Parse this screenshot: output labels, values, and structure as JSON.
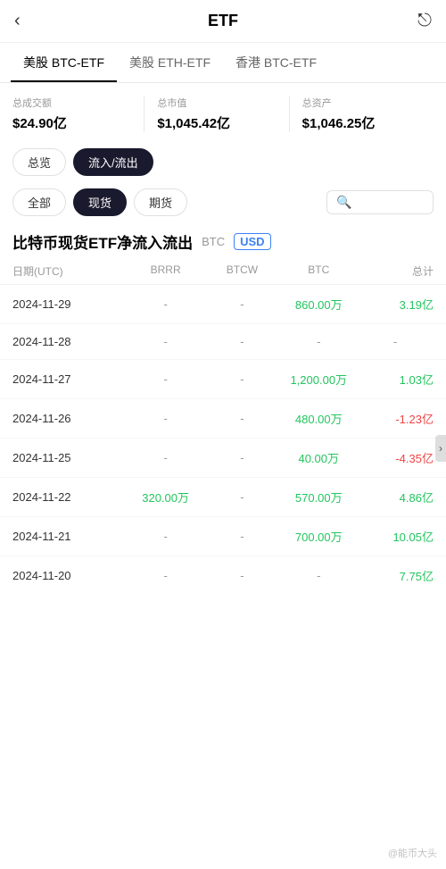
{
  "header": {
    "back_icon": "‹",
    "title": "ETF",
    "share_icon": "⎋"
  },
  "tabs": [
    {
      "label": "美股 BTC-ETF",
      "active": true
    },
    {
      "label": "美股 ETH-ETF",
      "active": false
    },
    {
      "label": "香港 BTC-ETF",
      "active": false
    }
  ],
  "stats": [
    {
      "label": "总成交额",
      "value": "$24.90亿"
    },
    {
      "label": "总市值",
      "value": "$1,045.42亿"
    },
    {
      "label": "总资产",
      "value": "$1,046.25亿"
    }
  ],
  "filter1": {
    "buttons": [
      {
        "label": "总览",
        "active": false
      },
      {
        "label": "流入/流出",
        "active": true
      }
    ]
  },
  "filter2": {
    "buttons": [
      {
        "label": "全部",
        "active": false
      },
      {
        "label": "现货",
        "active": true
      },
      {
        "label": "期货",
        "active": false
      }
    ],
    "search_placeholder": ""
  },
  "section": {
    "title": "比特币现货ETF净流入流出",
    "currency_btc": "BTC",
    "currency_usd": "USD"
  },
  "table": {
    "headers": [
      "日期(UTC)",
      "BRRR",
      "BTCW",
      "BTC",
      "总计"
    ],
    "rows": [
      {
        "date": "2024-11-29",
        "brrr": "-",
        "btcw": "-",
        "btc": "860.00万",
        "total": "3.19亿",
        "btc_color": "green",
        "total_color": "green"
      },
      {
        "date": "2024-11-28",
        "brrr": "-",
        "btcw": "-",
        "btc": "-",
        "total": "-",
        "btc_color": "dash",
        "total_color": "dash"
      },
      {
        "date": "2024-11-27",
        "brrr": "-",
        "btcw": "-",
        "btc": "1,200.00万",
        "total": "1.03亿",
        "btc_color": "green",
        "total_color": "green"
      },
      {
        "date": "2024-11-26",
        "brrr": "-",
        "btcw": "-",
        "btc": "480.00万",
        "total": "-1.23亿",
        "btc_color": "green",
        "total_color": "red"
      },
      {
        "date": "2024-11-25",
        "brrr": "-",
        "btcw": "-",
        "btc": "40.00万",
        "total": "-4.35亿",
        "btc_color": "green",
        "total_color": "red"
      },
      {
        "date": "2024-11-22",
        "brrr": "320.00万",
        "btcw": "-",
        "btc": "570.00万",
        "total": "4.86亿",
        "btc_color": "green",
        "total_color": "green",
        "brrr_color": "green"
      },
      {
        "date": "2024-11-21",
        "brrr": "-",
        "btcw": "-",
        "btc": "700.00万",
        "total": "10.05亿",
        "btc_color": "green",
        "total_color": "green"
      },
      {
        "date": "2024-11-20",
        "brrr": "-",
        "btcw": "-",
        "btc": "-",
        "total": "7.75亿",
        "btc_color": "dash",
        "total_color": "green"
      }
    ]
  },
  "watermark": "@能币大头",
  "scroll_arrow": "›"
}
